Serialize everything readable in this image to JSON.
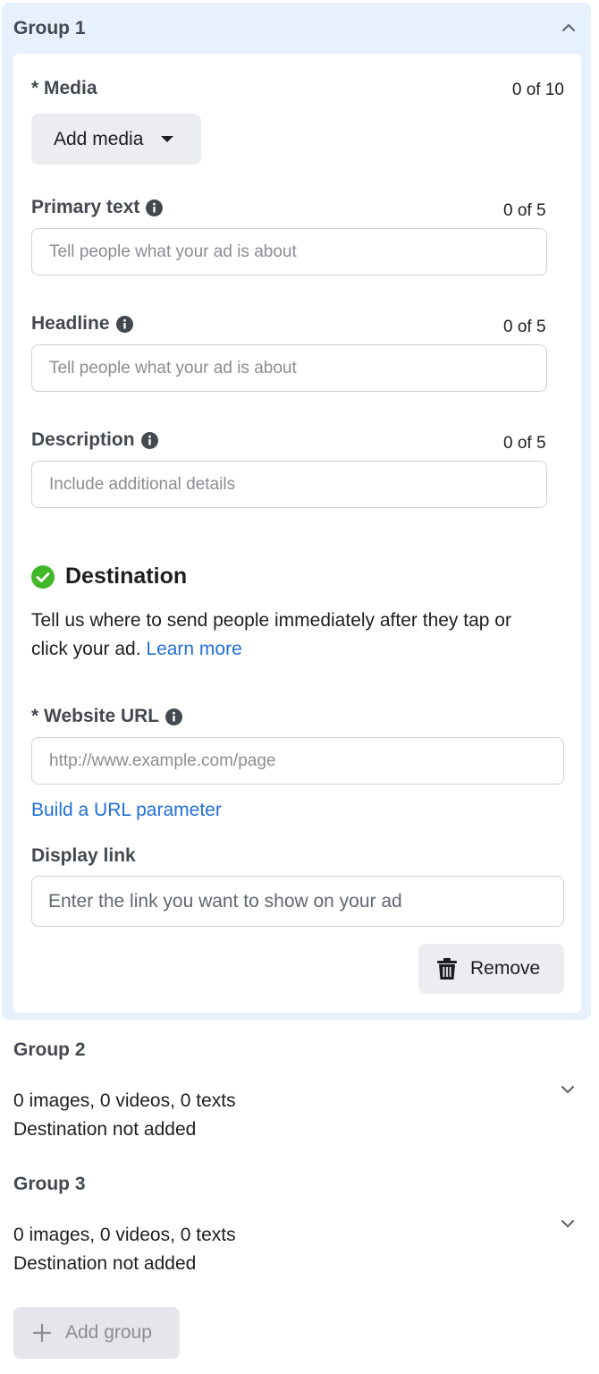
{
  "group1": {
    "title": "Group 1",
    "media": {
      "label": "* Media",
      "count": "0 of 10",
      "add_button": "Add media"
    },
    "primary_text": {
      "label": "Primary text",
      "count": "0 of 5",
      "placeholder": "Tell people what your ad is about"
    },
    "headline": {
      "label": "Headline",
      "count": "0 of 5",
      "placeholder": "Tell people what your ad is about"
    },
    "description": {
      "label": "Description",
      "count": "0 of 5",
      "placeholder": "Include additional details"
    },
    "destination": {
      "title": "Destination",
      "desc": "Tell us where to send people immediately after they tap or click your ad.",
      "learn_more": "Learn more",
      "website_url_label": "* Website URL",
      "website_url_placeholder": "http://www.example.com/page",
      "build_url_link": "Build a URL parameter",
      "display_link_label": "Display link",
      "display_link_placeholder": "Enter the link you want to show on your ad"
    },
    "remove_button": "Remove"
  },
  "group2": {
    "title": "Group 2",
    "summary_line1": "0 images, 0 videos, 0 texts",
    "summary_line2": "Destination not added"
  },
  "group3": {
    "title": "Group 3",
    "summary_line1": "0 images, 0 videos, 0 texts",
    "summary_line2": "Destination not added"
  },
  "add_group_button": "Add group",
  "colors": {
    "accent": "#216fdb",
    "success": "#42b72a",
    "group_bg": "#e7f0fd"
  },
  "icons": [
    "chevron-up-icon",
    "info-icon",
    "check-circle-icon",
    "trash-icon",
    "chevron-down-icon",
    "plus-icon"
  ]
}
